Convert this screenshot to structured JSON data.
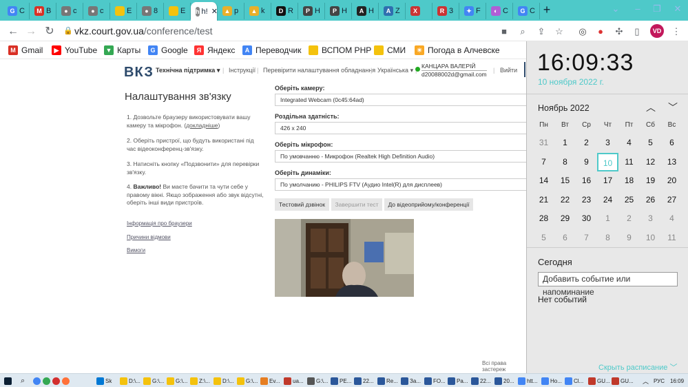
{
  "tabs": [
    {
      "label": "G",
      "title": "C",
      "color": "#4285f4"
    },
    {
      "label": "M",
      "title": "B",
      "color": "#d93025"
    },
    {
      "label": "●",
      "title": "c",
      "color": "#777"
    },
    {
      "label": "●",
      "title": "c",
      "color": "#777"
    },
    {
      "label": "",
      "title": "E",
      "color": "#f4c20d"
    },
    {
      "label": "●",
      "title": "8",
      "color": "#777"
    },
    {
      "label": "",
      "title": "E",
      "color": "#f4c20d"
    },
    {
      "label": "h",
      "title": "",
      "color": "#888"
    },
    {
      "label": "▲",
      "title": "p",
      "color": "#e8b02a"
    },
    {
      "label": "▲",
      "title": "k",
      "color": "#e8b02a"
    },
    {
      "label": "D",
      "title": "R",
      "color": "#111"
    },
    {
      "label": "P",
      "title": "H",
      "color": "#444"
    },
    {
      "label": "P",
      "title": "H",
      "color": "#444"
    },
    {
      "label": "A",
      "title": "H",
      "color": "#222"
    },
    {
      "label": "A",
      "title": "Z",
      "color": "#2f6fb0"
    },
    {
      "label": "X",
      "title": "",
      "color": "#c33"
    },
    {
      "label": "R",
      "title": "3",
      "color": "#c33"
    },
    {
      "label": "✦",
      "title": "F",
      "color": "#4285f4"
    },
    {
      "label": "◐",
      "title": "C",
      "color": "#b05fd6"
    },
    {
      "label": "G",
      "title": "C",
      "color": "#4285f4"
    }
  ],
  "active_tab_label": "h!",
  "address": {
    "host": "vkz.court.gov.ua",
    "path": "/conference/test"
  },
  "avatar": "VD",
  "bookmarks": [
    {
      "label": "Gmail",
      "icon": "gmail-icon",
      "color": "#d93025",
      "glyph": "M"
    },
    {
      "label": "YouTube",
      "icon": "youtube-icon",
      "color": "#f00",
      "glyph": "▶"
    },
    {
      "label": "Карты",
      "icon": "maps-icon",
      "color": "#34a853",
      "glyph": "▼"
    },
    {
      "label": "Google",
      "icon": "google-icon",
      "color": "#4285f4",
      "glyph": "G"
    },
    {
      "label": "Яндекс",
      "icon": "yandex-icon",
      "color": "#f33",
      "glyph": "Я"
    },
    {
      "label": "Переводчик",
      "icon": "translate-icon",
      "color": "#4285f4",
      "glyph": "A"
    },
    {
      "label": "ВСПОМ РНР",
      "icon": "folder-icon",
      "color": "#f4c20d",
      "glyph": ""
    },
    {
      "label": "СМИ",
      "icon": "folder-icon",
      "color": "#f4c20d",
      "glyph": ""
    },
    {
      "label": "Погода в Алчевске",
      "icon": "sun-icon",
      "color": "#f9a825",
      "glyph": "☀"
    }
  ],
  "site": {
    "logo": "ВКЗ",
    "nav": {
      "support": "Технічна підтримка",
      "instructions": "Інструкції",
      "check": "Перевірити налаштування обладнання",
      "language": "Українська",
      "user_name": "КАНЦАРА ВАЛЕРІЙ",
      "user_email": "d20088002d@gmail.com",
      "logout": "Вийти"
    },
    "title": "Налаштування зв'язку",
    "steps": {
      "s1a": "Дозвольте браузеру використовувати вашу камеру та мікрофон. (",
      "s1link": "докладніше",
      "s1b": ")",
      "s2": "Оберіть пристрої, що будуть використані під час відеоконференц-зв'язку.",
      "s3": "Натисніть кнопку «Подзвонити» для перевірки зв'язку.",
      "s4bold": "Важливо!",
      "s4": " Ви маєте бачити та чути себе у правому вікні. Якщо зображення або звук відсутні, оберіть інші види пристроїв."
    },
    "side_links": [
      "Інформація про браузери",
      "Причини відмови",
      "Вимоги"
    ],
    "fields": {
      "camera_label": "Оберіть камеру:",
      "camera_value": "Integrated Webcam (0c45:64ad)",
      "res_label": "Роздільна здатність:",
      "res_value": "426 x 240",
      "mic_label": "Оберіть мікрофон:",
      "mic_value": "По умовчанню - Микрофон (Realtek High Definition Audio)",
      "spk_label": "Оберіть динаміки:",
      "spk_value": "По умолчанию - PHILIPS FTV (Аудио Intel(R) для дисплеев)"
    },
    "buttons": {
      "test_call": "Тестовий дзвінок",
      "end_test": "Завершити тест",
      "to_conf": "До відеоприйому/конференції"
    },
    "rights": "Всі права застереж"
  },
  "calendar": {
    "time": "16:09:33",
    "date": "10 ноября 2022 г.",
    "month": "Ноябрь 2022",
    "weekdays": [
      "Пн",
      "Вт",
      "Ср",
      "Чт",
      "Пт",
      "Сб",
      "Вс"
    ],
    "days": [
      31,
      1,
      2,
      3,
      4,
      5,
      6,
      7,
      8,
      9,
      10,
      11,
      12,
      13,
      14,
      15,
      16,
      17,
      18,
      19,
      20,
      21,
      22,
      23,
      24,
      25,
      26,
      27,
      28,
      29,
      30,
      1,
      2,
      3,
      4,
      5,
      6,
      7,
      8,
      9,
      10,
      11
    ],
    "today_index": 10,
    "today_label": "Сегодня",
    "add_event": "Добавить событие или напоминание",
    "no_events": "Нет событий",
    "hide_schedule": "Скрыть расписание"
  },
  "taskbar": {
    "items": [
      {
        "label": "Sk",
        "color": "#0078d4"
      },
      {
        "label": "D:\\...",
        "color": "#f4c20d"
      },
      {
        "label": "G:\\...",
        "color": "#f4c20d"
      },
      {
        "label": "G:\\...",
        "color": "#f4c20d"
      },
      {
        "label": "Z:\\...",
        "color": "#f4c20d"
      },
      {
        "label": "D:\\...",
        "color": "#f4c20d"
      },
      {
        "label": "G:\\...",
        "color": "#f4c20d"
      },
      {
        "label": "Ev...",
        "color": "#e67e22"
      },
      {
        "label": "ua...",
        "color": "#c0392b"
      },
      {
        "label": "G:\\...",
        "color": "#555"
      },
      {
        "label": "PE...",
        "color": "#2b579a"
      },
      {
        "label": "22...",
        "color": "#2b579a"
      },
      {
        "label": "Re...",
        "color": "#2b579a"
      },
      {
        "label": "За...",
        "color": "#2b579a"
      },
      {
        "label": "FO...",
        "color": "#2b579a"
      },
      {
        "label": "Pa...",
        "color": "#2b579a"
      },
      {
        "label": "22...",
        "color": "#2b579a"
      },
      {
        "label": "20...",
        "color": "#2b579a"
      },
      {
        "label": "htt...",
        "color": "#4285f4"
      },
      {
        "label": "Ho...",
        "color": "#4285f4"
      },
      {
        "label": "Cl...",
        "color": "#4285f4"
      },
      {
        "label": "GU...",
        "color": "#c0392b"
      },
      {
        "label": "GU...",
        "color": "#c0392b"
      }
    ],
    "lang": "РУС",
    "time": "16:09"
  }
}
